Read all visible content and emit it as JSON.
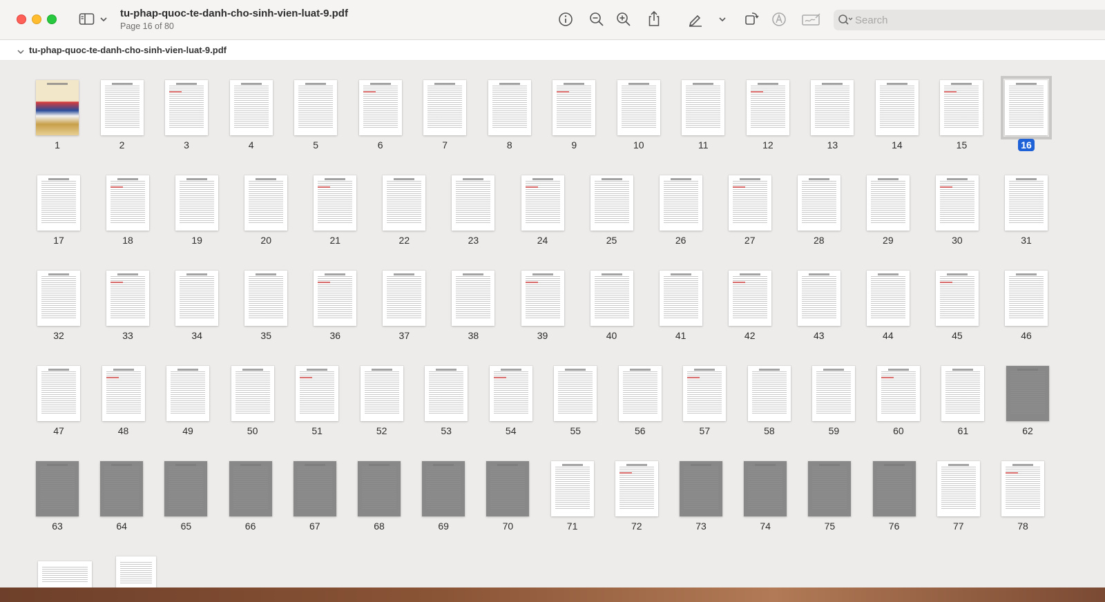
{
  "window": {
    "title": "tu-phap-quoc-te-danh-cho-sinh-vien-luat-9.pdf",
    "subtitle": "Page 16 of 80"
  },
  "toolbar": {
    "icons": [
      "sidebar-toggle-icon",
      "chevron-down-icon",
      "info-icon",
      "zoom-out-icon",
      "zoom-in-icon",
      "share-icon",
      "highlight-pen-icon",
      "chevron-down-icon",
      "rotate-icon",
      "markup-icon",
      "sign-icon",
      "search-icon"
    ],
    "search_placeholder": "Search"
  },
  "breadcrumb": {
    "label": "tu-phap-quoc-te-danh-cho-sinh-vien-luat-9.pdf"
  },
  "pages": {
    "total": 80,
    "selected": 16,
    "labels": [
      "1",
      "2",
      "3",
      "4",
      "5",
      "6",
      "7",
      "8",
      "9",
      "10",
      "11",
      "12",
      "13",
      "14",
      "15",
      "16",
      "17",
      "18",
      "19",
      "20",
      "21",
      "22",
      "23",
      "24",
      "25",
      "26",
      "27",
      "28",
      "29",
      "30",
      "31",
      "32",
      "33",
      "34",
      "35",
      "36",
      "37",
      "38",
      "39",
      "40",
      "41",
      "42",
      "43",
      "44",
      "45",
      "46",
      "47",
      "48",
      "49",
      "50",
      "51",
      "52",
      "53",
      "54",
      "55",
      "56",
      "57",
      "58",
      "59",
      "60",
      "61",
      "62",
      "63",
      "64",
      "65",
      "66",
      "67",
      "68",
      "69",
      "70",
      "71",
      "72",
      "73",
      "74",
      "75",
      "76",
      "77",
      "78"
    ]
  },
  "colors": {
    "selection": "#1f62d8",
    "background": "#eeecea"
  }
}
